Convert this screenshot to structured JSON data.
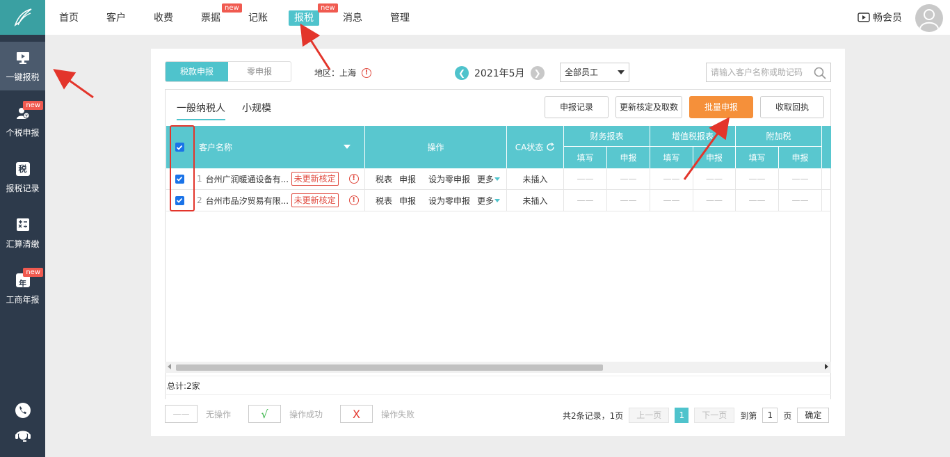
{
  "sidebar": {
    "items": [
      {
        "label": "一键报税",
        "icon": "monitor-icon"
      },
      {
        "label": "个税申报",
        "icon": "user-tax-icon",
        "badge": "new"
      },
      {
        "label": "报税记录",
        "icon": "tax-record-icon",
        "glyph": "税"
      },
      {
        "label": "汇算清缴",
        "icon": "calculator-icon"
      },
      {
        "label": "工商年报",
        "icon": "calendar-icon",
        "glyph": "年",
        "badge": "new"
      }
    ]
  },
  "nav": {
    "items": [
      {
        "label": "首页"
      },
      {
        "label": "客户"
      },
      {
        "label": "收费"
      },
      {
        "label": "票据",
        "badge": "new"
      },
      {
        "label": "记账"
      },
      {
        "label": "报税",
        "badge": "new"
      },
      {
        "label": "消息"
      },
      {
        "label": "管理"
      }
    ],
    "vip_label": "畅会员"
  },
  "toolbar": {
    "seg_tax": "税款申报",
    "seg_zero": "零申报",
    "region": "地区：上海",
    "warn_glyph": "!",
    "month": "2021年5月",
    "employee_select": "全部员工",
    "search_placeholder": "请输入客户名称或助记码"
  },
  "tabs": {
    "general": "一般纳税人",
    "small": "小规模"
  },
  "actions": {
    "record": "申报记录",
    "update": "更新核定及取数",
    "batch": "批量申报",
    "receipt": "收取回执"
  },
  "table": {
    "col_customer": "客户名称",
    "col_ops": "操作",
    "col_ca": "CA状态",
    "groups": [
      "财务报表",
      "增值税报表",
      "附加税"
    ],
    "sub_fill": "填写",
    "sub_submit": "申报",
    "rows": [
      {
        "idx": "1",
        "name": "台州广润暖通设备有...",
        "tag": "未更新核定",
        "op1": "税表",
        "op2": "申报",
        "op3": "设为零申报",
        "op4": "更多",
        "ca": "未插入",
        "dash": "——"
      },
      {
        "idx": "2",
        "name": "台州市品汐贸易有限...",
        "tag": "未更新核定",
        "op1": "税表",
        "op2": "申报",
        "op3": "设为零申报",
        "op4": "更多",
        "ca": "未插入",
        "dash": "——"
      }
    ]
  },
  "footer": {
    "total": "总计:2家",
    "legend_none": "无操作",
    "legend_ok": "操作成功",
    "legend_fail": "操作失败",
    "legend_ok_mark": "√",
    "legend_fail_mark": "X",
    "legend_none_mark": "——",
    "pager_info": "共2条记录，1页",
    "prev": "上一页",
    "page": "1",
    "next": "下一页",
    "goto": "到第",
    "goto_val": "1",
    "page_unit": "页",
    "confirm": "确定"
  },
  "colors": {
    "accent": "#4fc3cc",
    "header_bg": "#59c7cf",
    "sidebar_bg": "#2d3a4b",
    "orange": "#f5903a",
    "alert_red": "#e3352b"
  }
}
